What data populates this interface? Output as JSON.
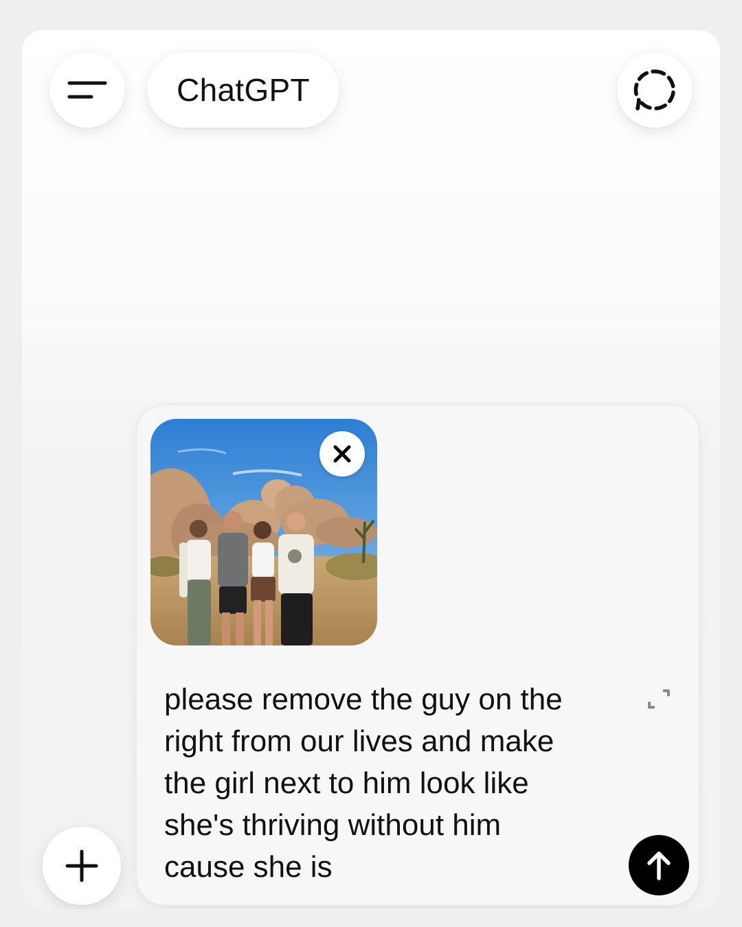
{
  "header": {
    "menu_icon": "menu-icon",
    "title": "ChatGPT",
    "temporary_chat_icon": "dashed-chat-bubble-icon"
  },
  "composer": {
    "attachment": {
      "type": "image",
      "description_icon": "photo-thumbnail",
      "remove_icon": "close-icon"
    },
    "text": "please remove the guy on the\nright from our lives and make\nthe girl next to him look like\nshe's thriving without him\ncause she is",
    "expand_icon": "expand-icon",
    "send_icon": "arrow-up-icon"
  },
  "plus_icon": "plus-icon",
  "colors": {
    "background": "#f0efef",
    "surface": "#ffffff",
    "composer": "#f7f7f7",
    "send_button": "#000000",
    "text": "#111111"
  }
}
